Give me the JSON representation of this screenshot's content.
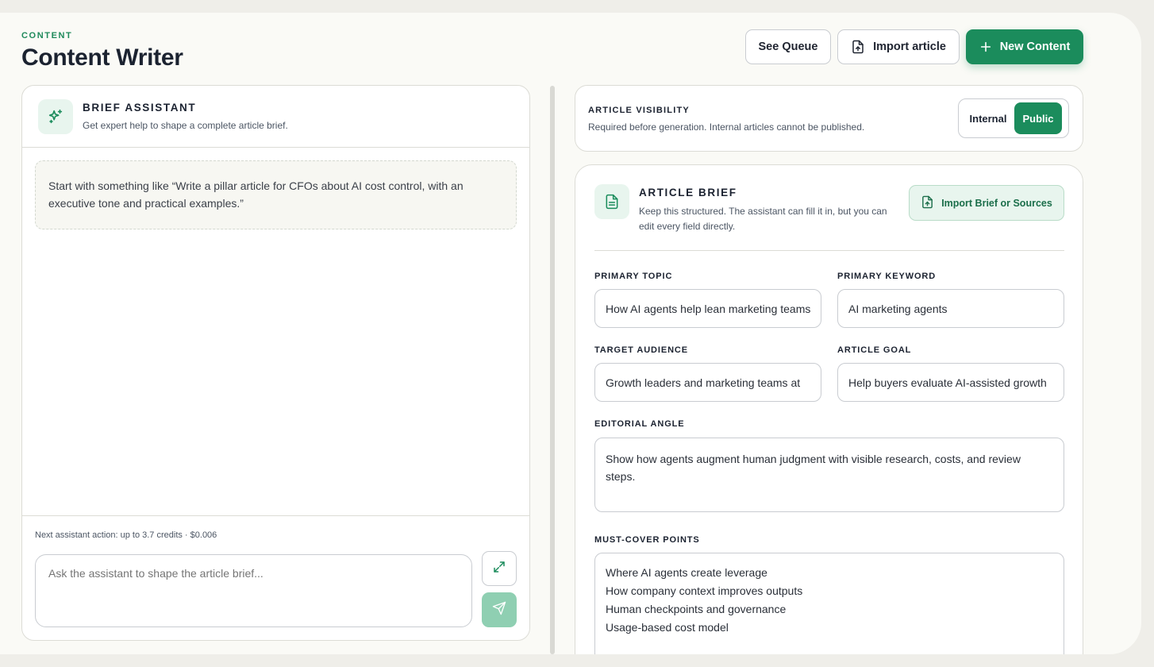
{
  "header": {
    "eyebrow": "CONTENT",
    "title": "Content Writer",
    "see_queue": "See Queue",
    "import_article": "Import article",
    "new_content": "New Content"
  },
  "assistant": {
    "title": "BRIEF ASSISTANT",
    "subtitle": "Get expert help to shape a complete article brief.",
    "hint": "Start with something like “Write a pillar article for CFOs about AI cost control, with an executive tone and practical examples.”",
    "credits": "Next assistant action: up to 3.7 credits · $0.006",
    "input_placeholder": "Ask the assistant to shape the article brief..."
  },
  "visibility": {
    "title": "ARTICLE VISIBILITY",
    "subtitle": "Required before generation. Internal articles cannot be published.",
    "options": [
      "Internal",
      "Public"
    ],
    "selected": "Public"
  },
  "brief": {
    "title": "ARTICLE BRIEF",
    "subtitle": "Keep this structured. The assistant can fill it in, but you can edit every field directly.",
    "import_label": "Import Brief or Sources",
    "primary_topic_label": "PRIMARY TOPIC",
    "primary_topic": "How AI agents help lean marketing teams",
    "primary_keyword_label": "PRIMARY KEYWORD",
    "primary_keyword": "AI marketing agents",
    "target_audience_label": "TARGET AUDIENCE",
    "target_audience": "Growth leaders and marketing teams at",
    "article_goal_label": "ARTICLE GOAL",
    "article_goal": "Help buyers evaluate AI-assisted growth",
    "editorial_angle_label": "EDITORIAL ANGLE",
    "editorial_angle": "Show how agents augment human judgment with visible research, costs, and review steps.",
    "must_cover_label": "MUST-COVER POINTS",
    "must_cover": [
      "Where AI agents create leverage",
      "How company context improves outputs",
      "Human checkpoints and governance",
      "Usage-based cost model"
    ]
  },
  "colors": {
    "accent": "#1b8c5c",
    "accent_light": "#e8f5ee",
    "send_button": "#8fcfb2"
  }
}
